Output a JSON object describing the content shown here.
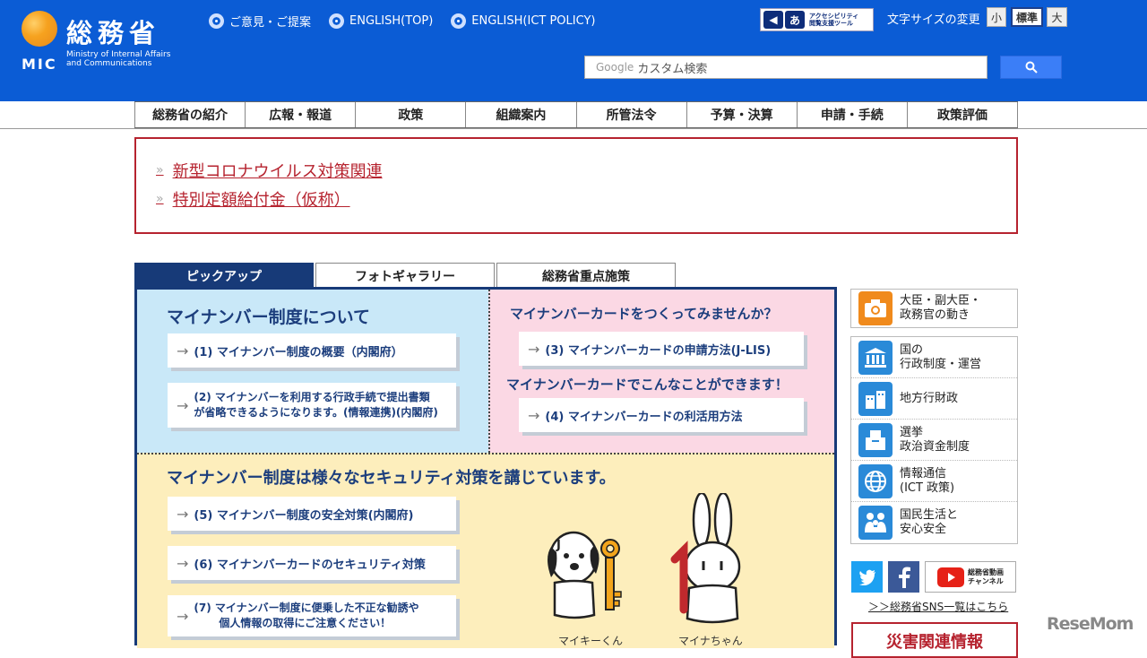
{
  "header": {
    "logo_name": "総務省",
    "logo_mic": "MIC",
    "logo_en_line1": "Ministry of Internal Affairs",
    "logo_en_line2": "and Communications",
    "links": [
      {
        "label": "ご意見・ご提案"
      },
      {
        "label": "ENGLISH(TOP)"
      },
      {
        "label": "ENGLISH(ICT POLICY)"
      }
    ],
    "accessibility_line1": "アクセシビリティ",
    "accessibility_line2": "閲覧支援ツール",
    "fontsize_label": "文字サイズの変更",
    "fontsize_small": "小",
    "fontsize_std": "標準",
    "fontsize_large": "大",
    "search_google": "Google",
    "search_placeholder": "カスタム検索"
  },
  "nav": {
    "items": [
      "総務省の紹介",
      "広報・報道",
      "政策",
      "組織案内",
      "所管法令",
      "予算・決算",
      "申請・手続",
      "政策評価"
    ]
  },
  "alert": {
    "links": [
      "新型コロナウイルス対策関連",
      "特別定額給付金（仮称）"
    ]
  },
  "tabs": [
    {
      "label": "ピックアップ",
      "active": true
    },
    {
      "label": "フォトギャラリー",
      "active": false
    },
    {
      "label": "総務省重点施策",
      "active": false
    }
  ],
  "panel": {
    "blue_title": "マイナンバー制度について",
    "blue_btn1": "(1) マイナンバー制度の概要（内閣府）",
    "blue_btn2_l1": "(2) マイナンバーを利用する行政手続で提出書類",
    "blue_btn2_l2": "が省略できるようになります。(情報連携)(内閣府)",
    "pink_title1": "マイナンバーカードをつくってみませんか？",
    "pink_btn3": "(3) マイナンバーカードの申請方法(J-LIS)",
    "pink_title2": "マイナンバーカードでこんなことができます！",
    "pink_btn4": "(4) マイナンバーカードの利活用方法",
    "yellow_title": "マイナンバー制度は様々なセキュリティ対策を講じています。",
    "yellow_btn5": "(5) マイナンバー制度の安全対策(内閣府)",
    "yellow_btn6": "(6) マイナンバーカードのセキュリティ対策",
    "yellow_btn7_l1": "(7) マイナンバー制度に便乗した不正な勧誘や",
    "yellow_btn7_l2": "個人情報の取得にご注意ください！",
    "mascot1": "マイキーくん",
    "mascot2": "マイナちゃん"
  },
  "sidebar": {
    "top_item": "大臣・副大臣・\n政務官の動き",
    "items": [
      {
        "label": "国の\n行政制度・運営"
      },
      {
        "label": "地方行財政"
      },
      {
        "label": "選挙\n政治資金制度"
      },
      {
        "label": "情報通信\n(ICT 政策)"
      },
      {
        "label": "国民生活と\n安心安全"
      }
    ],
    "youtube_line1": "総務省動画",
    "youtube_line2": "チャンネル",
    "sns_link": "＞＞総務省SNS一覧はこちら",
    "disaster": "災害関連情報"
  },
  "watermark": "ReseMom",
  "colors": {
    "header_bg": "#0b5cd5",
    "alert_red": "#b6232f",
    "panel_navy": "#173a78",
    "side_icon_blue": "#2a8ad8",
    "side_icon_orange": "#f08a1c"
  }
}
